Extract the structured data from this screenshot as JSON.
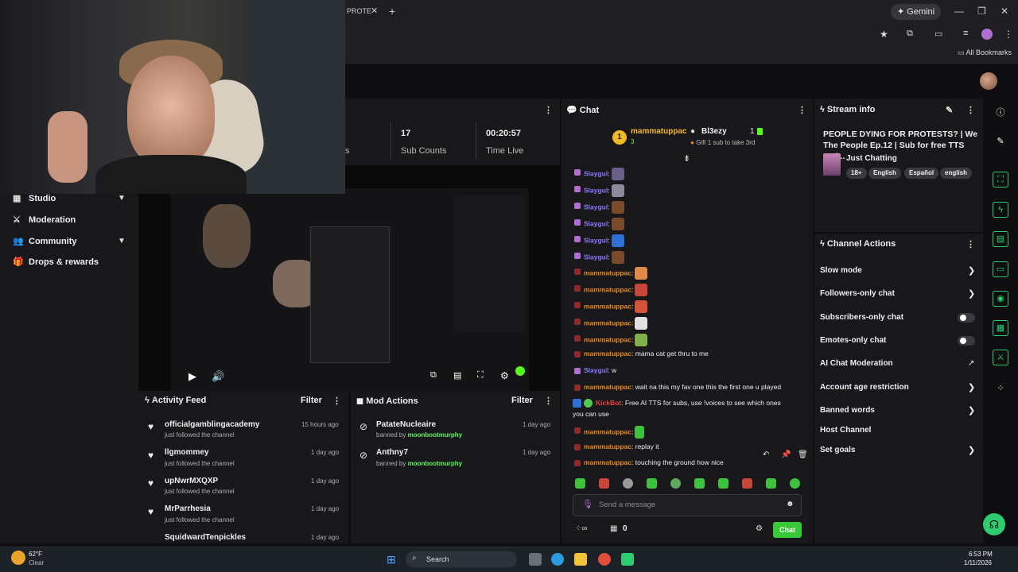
{
  "browser": {
    "tab_title": "PROTE",
    "gemini_label": "Gemini",
    "bookmarks_label": "All Bookmarks"
  },
  "nav": {
    "items": [
      {
        "label": "Studio"
      },
      {
        "label": "Moderation"
      },
      {
        "label": "Community"
      },
      {
        "label": "Drops & rewards"
      }
    ]
  },
  "stats": {
    "partial_label": "s",
    "sub_counts_value": "17",
    "sub_counts_label": "Sub Counts",
    "time_live_value": "00:20:57",
    "time_live_label": "Time Live"
  },
  "activity_feed": {
    "title": "Activity Feed",
    "filter": "Filter",
    "items": [
      {
        "name": "officialgamblingacademy",
        "action": "just followed the channel",
        "time": "15 hours ago"
      },
      {
        "name": "llgmommey",
        "action": "just followed the channel",
        "time": "1 day ago"
      },
      {
        "name": "upNwrMXQXP",
        "action": "just followed the channel",
        "time": "1 day ago"
      },
      {
        "name": "MrParrhesia",
        "action": "just followed the channel",
        "time": "1 day ago"
      },
      {
        "name": "SquidwardTenpickles",
        "action": "",
        "time": "1 day ago"
      }
    ]
  },
  "mod_actions": {
    "title": "Mod Actions",
    "filter": "Filter",
    "items": [
      {
        "name": "PatateNucleaire",
        "by_prefix": "banned by",
        "by": "moonbootmurphy",
        "time": "1 day ago"
      },
      {
        "name": "Anthny7",
        "by_prefix": "banned by",
        "by": "moonbootmurphy",
        "time": "1 day ago"
      }
    ]
  },
  "chat": {
    "title": "Chat",
    "top_rank": "1",
    "top_user": "mammatuppac",
    "top_user_count": "3",
    "second_user": "Bl3ezy",
    "second_count": "1",
    "gift_text": "Gift 1 sub to take 3rd",
    "messages": [
      {
        "user": "Slaygul",
        "sep": ":",
        "text": ""
      },
      {
        "user": "Slaygul",
        "sep": ":",
        "text": ""
      },
      {
        "user": "Slaygul",
        "sep": ":",
        "text": ""
      },
      {
        "user": "Slaygul",
        "sep": ":",
        "text": ""
      },
      {
        "user": "Slaygul",
        "sep": ":",
        "text": ""
      },
      {
        "user": "Slaygul",
        "sep": ":",
        "text": ""
      },
      {
        "user": "mammatuppac",
        "sep": ":",
        "text": ""
      },
      {
        "user": "mammatuppac",
        "sep": ":",
        "text": ""
      },
      {
        "user": "mammatuppac",
        "sep": ":",
        "text": ""
      },
      {
        "user": "mammatuppac",
        "sep": ":",
        "text": ""
      },
      {
        "user": "mammatuppac",
        "sep": ":",
        "text": ""
      },
      {
        "user": "mammatuppac",
        "sep": ":",
        "text": " mama cat get thru to me"
      },
      {
        "user": "Slaygul",
        "sep": ":",
        "text": " w"
      },
      {
        "user": "mammatuppac",
        "sep": ":",
        "text": " wait na this my fav one this the first one u played"
      },
      {
        "user": "KickBot",
        "sep": ":",
        "text": " Free AI TTS for subs, use !voices to see which ones"
      },
      {
        "user": "",
        "sep": "",
        "text": "you can use"
      },
      {
        "user": "mammatuppac",
        "sep": ":",
        "text": ""
      },
      {
        "user": "mammatuppac",
        "sep": ":",
        "text": " replay it"
      },
      {
        "user": "mammatuppac",
        "sep": ":",
        "text": " touching the ground how nice"
      }
    ],
    "input_placeholder": "Send a message",
    "points": "0",
    "chat_button": "Chat"
  },
  "stream_info": {
    "title": "Stream info",
    "stream_title": "PEOPLE DYING FOR PROTESTS? | We The People Ep.12 | Sub for free TTS and...",
    "category": "Just Chatting",
    "tags": [
      "18+",
      "English",
      "Español",
      "english"
    ]
  },
  "channel_actions": {
    "title": "Channel Actions",
    "items": [
      {
        "label": "Slow mode",
        "control": "chevron"
      },
      {
        "label": "Followers-only chat",
        "control": "chevron"
      },
      {
        "label": "Subscribers-only chat",
        "control": "toggle"
      },
      {
        "label": "Emotes-only chat",
        "control": "toggle"
      },
      {
        "label": "AI Chat Moderation",
        "control": "external"
      },
      {
        "label": "Account age restriction",
        "control": "chevron"
      },
      {
        "label": "Banned words",
        "control": "chevron"
      },
      {
        "label": "Host Channel",
        "control": "none"
      },
      {
        "label": "Set goals",
        "control": "chevron"
      }
    ]
  },
  "taskbar": {
    "weather_temp": "62°F",
    "weather_desc": "Clear",
    "search_label": "Search",
    "time": "6:53 PM",
    "date": "1/11/2026"
  },
  "colors": {
    "accent_green": "#53fc18",
    "chat_button": "#38c938",
    "username_slaygul": "#8a7bff",
    "username_mammatuppac": "#e88a1c",
    "username_kickbot": "#e6403a"
  }
}
